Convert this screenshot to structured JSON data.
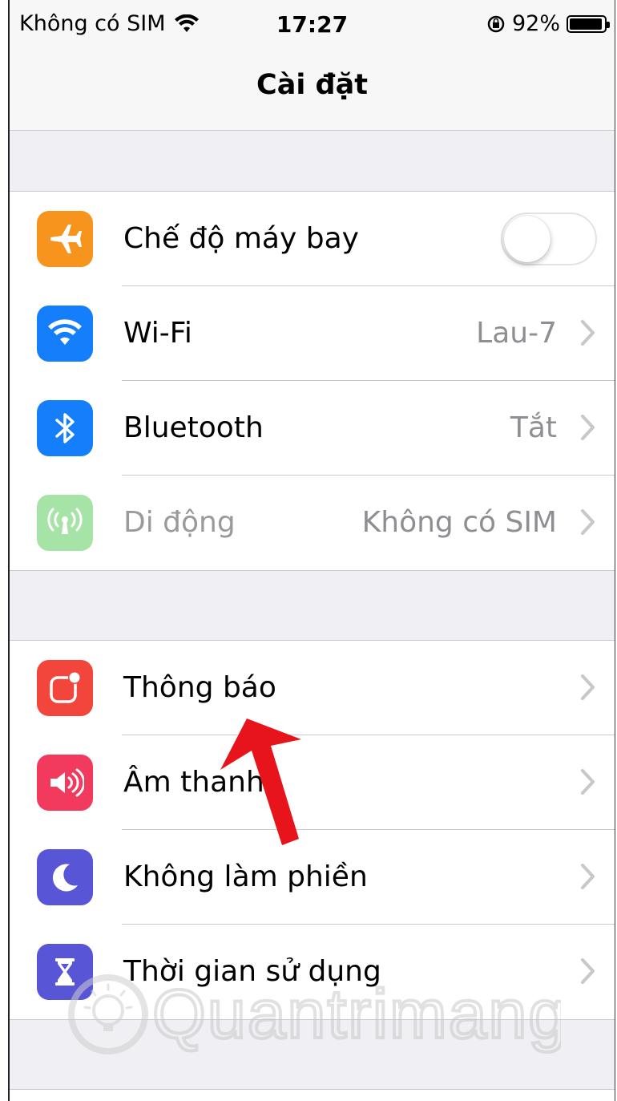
{
  "status_bar": {
    "carrier": "Không có SIM",
    "time": "17:27",
    "battery": "92%"
  },
  "nav": {
    "title": "Cài đặt"
  },
  "groups": [
    {
      "rows": [
        {
          "label": "Chế độ máy bay",
          "icon": "airplane-icon",
          "icon_color": "#f7941d",
          "toggle": false
        },
        {
          "label": "Wi-Fi",
          "value": "Lau-7",
          "icon": "wifi-icon",
          "icon_color": "#147efb"
        },
        {
          "label": "Bluetooth",
          "value": "Tắt",
          "icon": "bluetooth-icon",
          "icon_color": "#147efb"
        },
        {
          "label": "Di động",
          "value": "Không có SIM",
          "icon": "cellular-icon",
          "icon_color": "#a6e3a6",
          "disabled": true
        }
      ]
    },
    {
      "rows": [
        {
          "label": "Thông báo",
          "icon": "notifications-icon",
          "icon_color": "#f2463c"
        },
        {
          "label": "Âm thanh",
          "icon": "sound-icon",
          "icon_color": "#f23b5c"
        },
        {
          "label": "Không làm phiền",
          "icon": "moon-icon",
          "icon_color": "#5856d6"
        },
        {
          "label": "Thời gian sử dụng",
          "icon": "hourglass-icon",
          "icon_color": "#5856d6"
        }
      ]
    }
  ],
  "watermark": {
    "text": "Quantrimang"
  },
  "annotation": {
    "arrow_color": "#e8141c"
  }
}
